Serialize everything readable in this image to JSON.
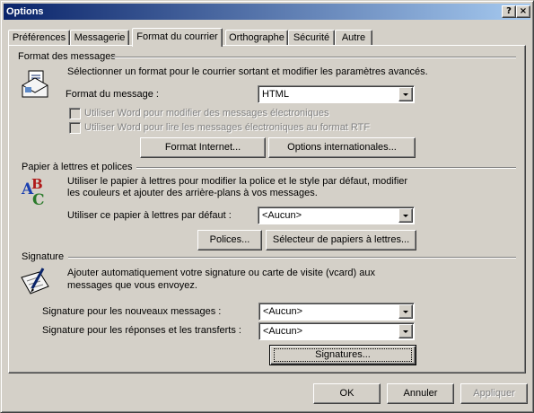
{
  "window": {
    "title": "Options",
    "help_label": "?",
    "close_label": "×"
  },
  "tabs": [
    {
      "label": "Préférences"
    },
    {
      "label": "Messagerie"
    },
    {
      "label": "Format du courrier",
      "active": true
    },
    {
      "label": "Orthographe"
    },
    {
      "label": "Sécurité"
    },
    {
      "label": "Autre"
    }
  ],
  "format_section": {
    "title": "Format des messages",
    "description": "Sélectionner un format pour le courrier sortant et modifier les paramètres avancés.",
    "format_label": "Format du message :",
    "format_value": "HTML",
    "word_edit_label": "Utiliser Word pour modifier des messages électroniques",
    "word_edit_checked": false,
    "word_read_label": "Utiliser Word pour lire les messages électroniques au format RTF",
    "word_read_checked": false,
    "internet_format_button": "Format Internet...",
    "international_button": "Options internationales..."
  },
  "stationery_section": {
    "title": "Papier à lettres et polices",
    "description_line1": "Utiliser le papier à lettres pour modifier la police et le style par défaut, modifier",
    "description_line2": "les couleurs et ajouter des arrière-plans à vos messages.",
    "default_label": "Utiliser ce papier à lettres par défaut :",
    "default_value": "<Aucun>",
    "fonts_button": "Polices...",
    "selector_button": "Sélecteur de papiers à lettres..."
  },
  "signature_section": {
    "title": "Signature",
    "description_line1": "Ajouter automatiquement votre signature ou carte de visite (vcard) aux",
    "description_line2": "messages que vous envoyez.",
    "new_label": "Signature pour les nouveaux messages :",
    "new_value": "<Aucun>",
    "reply_label": "Signature pour les réponses et les transferts :",
    "reply_value": "<Aucun>",
    "signatures_button": "Signatures..."
  },
  "footer": {
    "ok": "OK",
    "cancel": "Annuler",
    "apply": "Appliquer"
  },
  "colors": {
    "face": "#d4d0c8",
    "title_start": "#0a246a",
    "title_end": "#a6caf0",
    "disabled_text": "#808080"
  }
}
